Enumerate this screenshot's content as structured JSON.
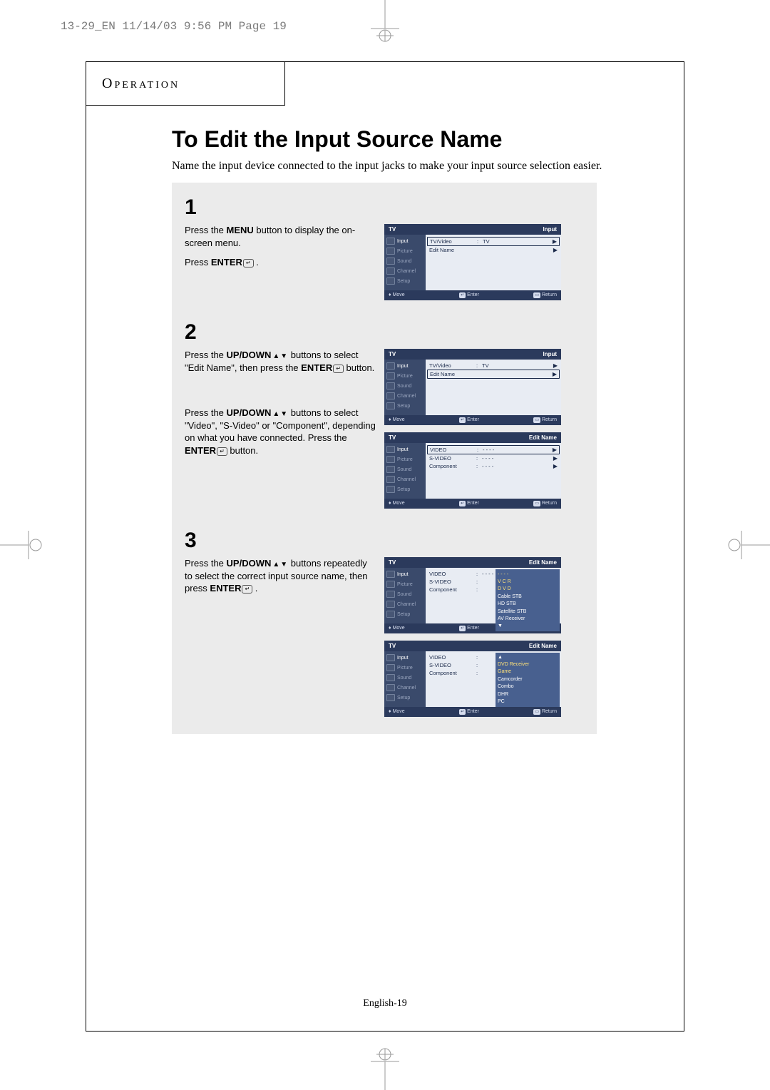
{
  "header": "13-29_EN  11/14/03 9:56 PM  Page 19",
  "section": "Operation",
  "title": "To Edit the Input Source Name",
  "intro": "Name the input device connected to the input jacks to make your input source selection easier.",
  "steps": {
    "s1": {
      "num": "1",
      "p1a": "Press the ",
      "p1b": "MENU",
      "p1c": " button to display the on-screen menu.",
      "p2a": "Press ",
      "p2b": "ENTER",
      "p2c": " ."
    },
    "s2": {
      "num": "2",
      "p1a": "Press the ",
      "p1b": "UP/DOWN",
      "p1c": " buttons to select \"Edit Name\", then press the ",
      "p1d": "ENTER",
      "p1e": " button.",
      "p2a": "Press the ",
      "p2b": "UP/DOWN",
      "p2c": " buttons to select \"Video\", \"S-Video\" or \"Component\", depending on what you  have connected. Press the ",
      "p2d": "ENTER",
      "p2e": " button."
    },
    "s3": {
      "num": "3",
      "p1a": "Press the ",
      "p1b": "UP/DOWN",
      "p1c": " buttons repeatedly to select the correct input source name, then press ",
      "p1d": "ENTER",
      "p1e": " ."
    }
  },
  "osd_common": {
    "brand": "TV",
    "side": {
      "input": "Input",
      "picture": "Picture",
      "sound": "Sound",
      "channel": "Channel",
      "setup": "Setup"
    },
    "ftr_move": "Move",
    "ftr_enter": "Enter",
    "ftr_return": "Return"
  },
  "osd1": {
    "hdr_right": "Input",
    "r1_lab": "TV/Video",
    "r1_val": "TV",
    "r2_lab": "Edit Name"
  },
  "osd2a": {
    "hdr_right": "Input",
    "r1_lab": "TV/Video",
    "r1_val": "TV",
    "r2_lab": "Edit Name"
  },
  "osd2b": {
    "hdr_right": "Edit Name",
    "r1_lab": "VIDEO",
    "r1_val": "- - - -",
    "r2_lab": "S-VIDEO",
    "r2_val": "- - - -",
    "r3_lab": "Component",
    "r3_val": "- - - -"
  },
  "osd3a": {
    "hdr_right": "Edit Name",
    "r1_lab": "VIDEO",
    "r1_val": "- - - -",
    "r2_lab": "S-VIDEO",
    "r3_lab": "Component",
    "dd": {
      "o1": "V C R",
      "o2": "D V D",
      "o3": "Cable STB",
      "o4": "HD STB",
      "o5": "Satellite STB",
      "o6": "AV Receiver"
    }
  },
  "osd3b": {
    "hdr_right": "Edit Name",
    "r1_lab": "VIDEO",
    "r2_lab": "S-VIDEO",
    "r2_val": "DVD Receiver",
    "r3_lab": "Component",
    "dd": {
      "o1": "Game",
      "o2": "Camcorder",
      "o3": "Combo",
      "o4": "DHR",
      "o5": "PC"
    }
  },
  "footer": {
    "lang": "English-",
    "page": "19"
  }
}
